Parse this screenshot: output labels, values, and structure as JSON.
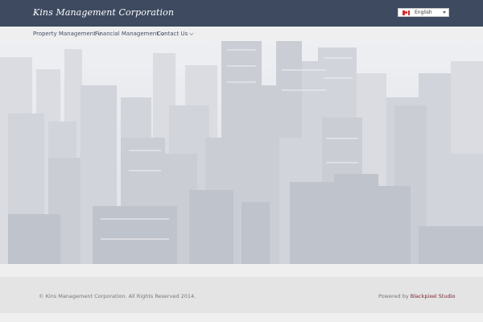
{
  "header": {
    "logo_text": "Kins Management Corporation",
    "language": {
      "selected": "English",
      "flag_icon": "canada-flag-icon"
    }
  },
  "nav": {
    "items": [
      {
        "label": "Property Management",
        "has_dropdown": true
      },
      {
        "label": "Financial Management",
        "has_dropdown": true
      },
      {
        "label": "Contact Us",
        "has_dropdown": true
      }
    ]
  },
  "hero": {
    "image": "city-skyline-aerial"
  },
  "footer": {
    "copyright": "© Kins Management Corporation. All Rights Reserved 2014.",
    "powered_prefix": "Powered by",
    "powered_link": "Blackpixel Studio"
  },
  "colors": {
    "header_bg": "#3d4a5f",
    "nav_text": "#445066",
    "link_accent": "#7a2430",
    "footer_bg": "#e4e4e4"
  }
}
